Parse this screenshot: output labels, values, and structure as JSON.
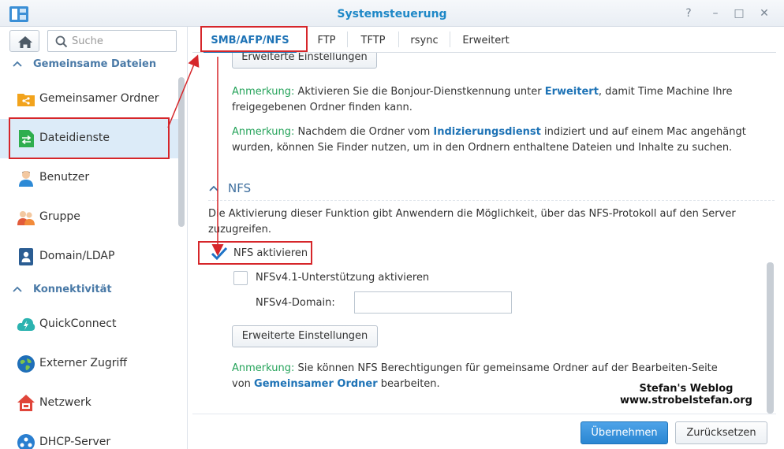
{
  "window": {
    "title": "Systemsteuerung",
    "help_glyph": "?",
    "minimize_glyph": "–",
    "maximize_glyph": "□",
    "close_glyph": "✕"
  },
  "sidebar": {
    "search_placeholder": "Suche",
    "sections": [
      {
        "label": "Gemeinsame Dateien",
        "items": [
          {
            "label": "Gemeinsamer Ordner",
            "icon": "shared-folder-icon"
          },
          {
            "label": "Dateidienste",
            "icon": "file-services-icon",
            "active": true
          },
          {
            "label": "Benutzer",
            "icon": "user-icon"
          },
          {
            "label": "Gruppe",
            "icon": "group-icon"
          },
          {
            "label": "Domain/LDAP",
            "icon": "domain-ldap-icon"
          }
        ]
      },
      {
        "label": "Konnektivität",
        "items": [
          {
            "label": "QuickConnect",
            "icon": "quickconnect-icon"
          },
          {
            "label": "Externer Zugriff",
            "icon": "external-access-icon"
          },
          {
            "label": "Netzwerk",
            "icon": "network-icon"
          },
          {
            "label": "DHCP-Server",
            "icon": "dhcp-server-icon"
          }
        ]
      }
    ]
  },
  "tabs": [
    {
      "label": "SMB/AFP/NFS",
      "active": true
    },
    {
      "label": "FTP"
    },
    {
      "label": "TFTP"
    },
    {
      "label": "rsync"
    },
    {
      "label": "Erweitert"
    }
  ],
  "content": {
    "top_button": "Erweiterte Einstellungen",
    "note_label": "Anmerkung:",
    "note1": {
      "before": " Aktivieren Sie die Bonjour-Dienstkennung unter ",
      "link": "Erweitert",
      "after": ", damit Time Machine Ihre freigegebenen Ordner finden kann."
    },
    "note2": {
      "before": " Nachdem die Ordner vom ",
      "link": "Indizierungsdienst",
      "after": " indiziert und auf einem Mac angehängt wurden, können Sie Finder nutzen, um in den Ordnern enthaltene Dateien und Inhalte zu suchen."
    },
    "nfs": {
      "title": "NFS",
      "description": "Die Aktivierung dieser Funktion gibt Anwendern die Möglichkeit, über das NFS-Protokoll auf den Server zuzugreifen.",
      "enable_label": "NFS aktivieren",
      "enable_checked": true,
      "nfsv41_label": "NFSv4.1-Unterstützung aktivieren",
      "nfsv41_checked": false,
      "domain_label": "NFSv4-Domain:",
      "domain_value": "",
      "advanced_button": "Erweiterte Einstellungen",
      "note3": {
        "before": " Sie können NFS Berechtigungen für gemeinsame Ordner auf der Bearbeiten-Seite von ",
        "link": "Gemeinsamer Ordner",
        "after": " bearbeiten."
      }
    }
  },
  "footer": {
    "apply_label": "Übernehmen",
    "reset_label": "Zurücksetzen"
  },
  "watermark": {
    "line1": "Stefan's Weblog",
    "line2": "www.strobelstefan.org"
  },
  "colors": {
    "accent": "#1e73b6",
    "note_green": "#25a35a",
    "highlight_red": "#d6262a",
    "active_nav_bg": "#dcebf8"
  }
}
